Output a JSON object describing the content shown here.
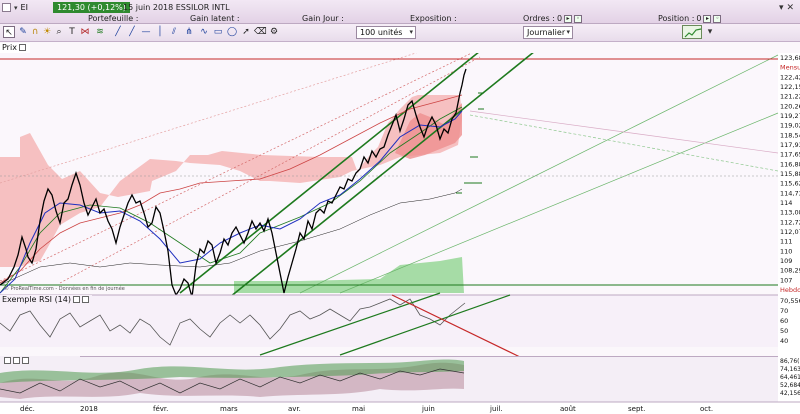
{
  "header": {
    "window_label": "EI",
    "price_badge": "121,30 (+0,12%)",
    "security_name": "15 juin 2018 ESSILOR INTL",
    "columns": [
      {
        "label": "Portefeuille :",
        "value": ""
      },
      {
        "label": "Gain latent :",
        "value": ""
      },
      {
        "label": "Gain Jour :",
        "value": ""
      },
      {
        "label": "Exposition :",
        "value": ""
      },
      {
        "label": "Ordres :",
        "value": "0"
      },
      {
        "label": "Position :",
        "value": "0"
      }
    ]
  },
  "toolbar": {
    "quantity": "100 unités",
    "period": "Journalier"
  },
  "panels": {
    "price_label": "Prix",
    "rsi_label": "Exemple RSI (14)",
    "source_note": "© ProRealTime.com - Données en fin de journée"
  },
  "price_axis": {
    "labels": [
      "123,68",
      "Mensuel",
      "122,42",
      "122,15",
      "121,22",
      "120,26",
      "119,27",
      "119,02",
      "118,54",
      "117,93",
      "117,65",
      "116,88",
      "115,88",
      "115,62",
      "114,73",
      "114",
      "113,08",
      "112,72",
      "112,07",
      "111",
      "110",
      "109",
      "108,29",
      "107",
      "Hebdo"
    ]
  },
  "rsi_axis": {
    "labels": [
      "70,556",
      "70",
      "60",
      "50",
      "40"
    ]
  },
  "bottom_axis": {
    "labels": [
      "86,76(",
      "74,163",
      "64,461",
      "52,684",
      "42,156"
    ]
  },
  "time_axis": {
    "labels": [
      "déc.",
      "2018",
      "févr.",
      "mars",
      "avr.",
      "mai",
      "juin",
      "juil.",
      "août",
      "sept.",
      "oct."
    ]
  },
  "colors": {
    "up": "#2f8a2f",
    "price_line": "#000000",
    "ma_blue": "#1f2fbf",
    "trend_green": "#1e7a1e",
    "cloud_red": "#f4a8a8",
    "cloud_green": "#8fd08f",
    "resistance_red": "#c62828"
  }
}
